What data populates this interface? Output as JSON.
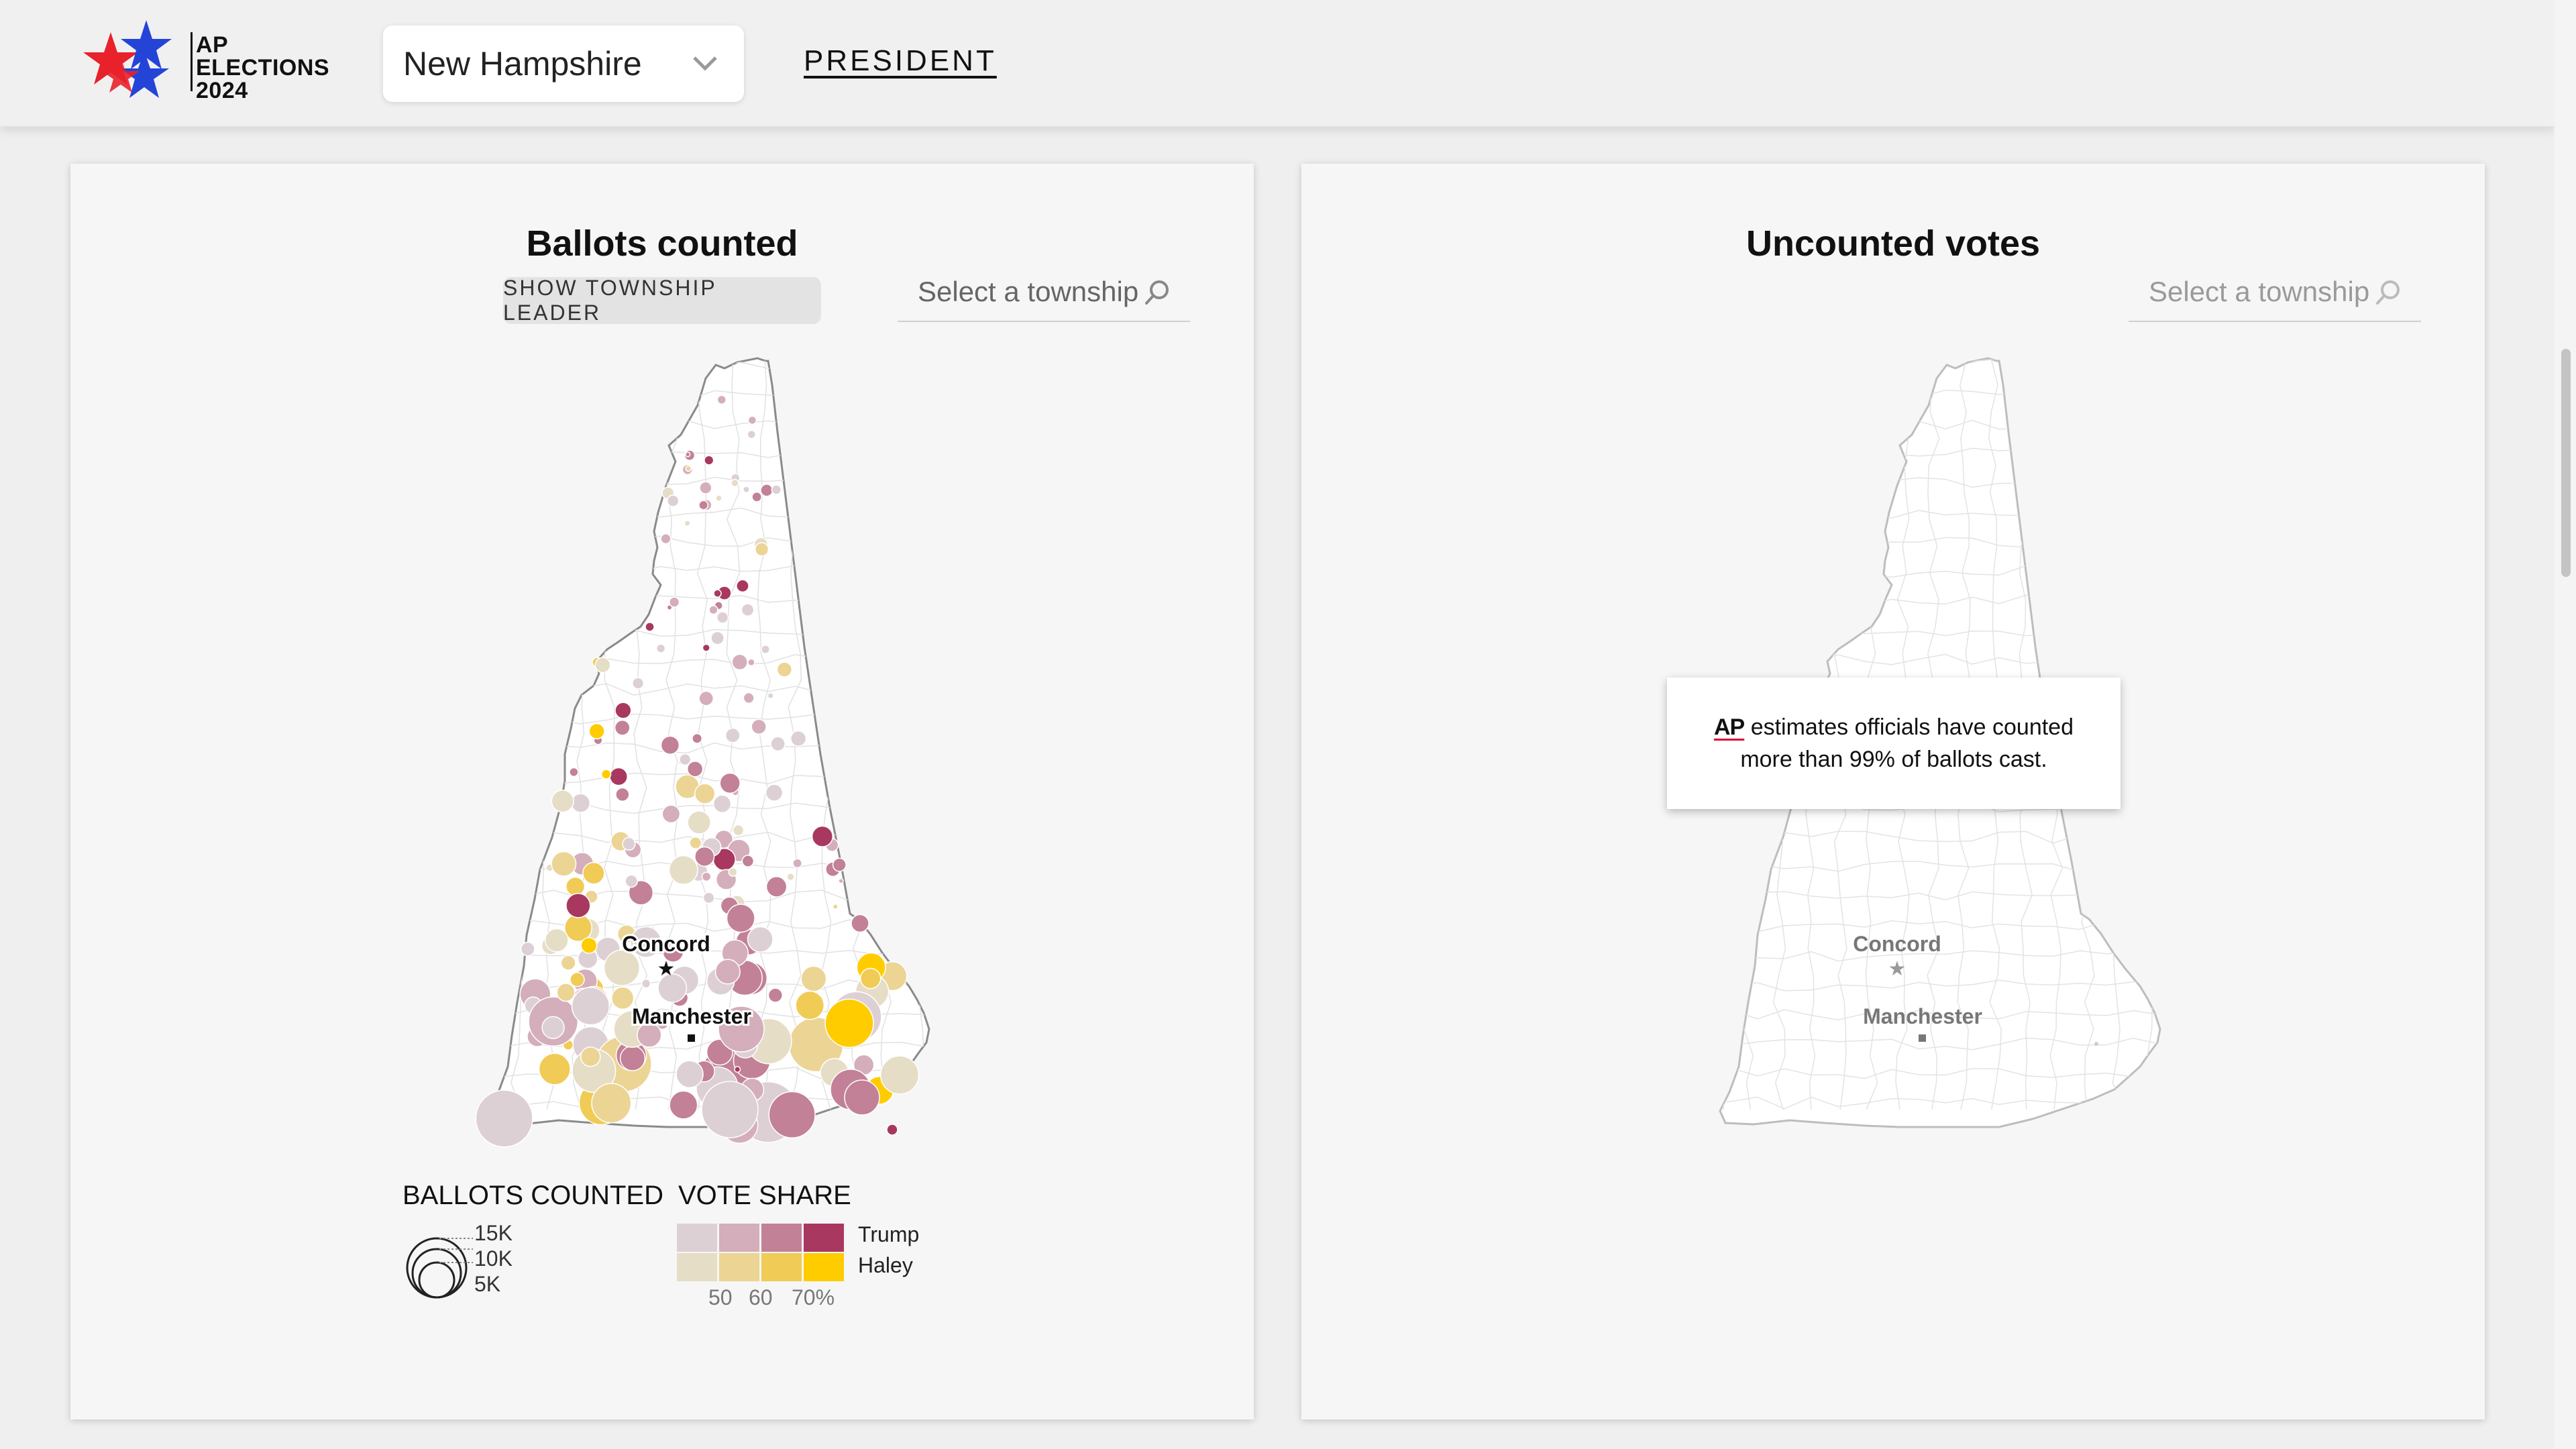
{
  "header": {
    "logo": {
      "line1": "AP",
      "line2": "ELECTIONS",
      "line3": "2024"
    },
    "state_select": {
      "value": "New Hampshire"
    },
    "nav_link": "PRESIDENT"
  },
  "left_panel": {
    "title": "Ballots counted",
    "leader_button": "SHOW TOWNSHIP LEADER",
    "search_placeholder": "Select a township",
    "cities": {
      "concord": "Concord",
      "manchester": "Manchester"
    },
    "legend": {
      "ballots_heading": "BALLOTS COUNTED",
      "sizes": [
        "15K",
        "10K",
        "5K"
      ],
      "share_heading": "VOTE SHARE",
      "candidates": [
        "Trump",
        "Haley"
      ],
      "ticks": [
        "50",
        "60",
        "70%"
      ],
      "trump_colors": [
        "#ddd0d5",
        "#d4aebb",
        "#c28196",
        "#a8385f"
      ],
      "haley_colors": [
        "#e6ddc6",
        "#ecd494",
        "#f0cb55",
        "#ffcc00"
      ]
    }
  },
  "right_panel": {
    "title": "Uncounted votes",
    "search_placeholder": "Select a township",
    "cities": {
      "concord": "Concord",
      "manchester": "Manchester"
    },
    "tooltip": {
      "ap": "AP",
      "text": "estimates officials have counted more than 99% of ballots cast."
    }
  }
}
